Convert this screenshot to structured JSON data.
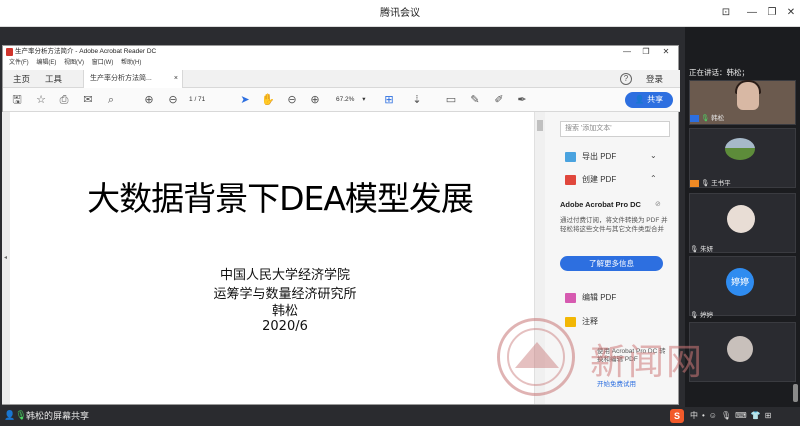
{
  "meeting": {
    "title": "腾讯会议",
    "speaking_label": "正在讲话：韩松；",
    "share_label": "韩松的屏幕共享"
  },
  "acrobat": {
    "window_title": "生产率分析方法简介 - Adobe Acrobat Reader DC",
    "menu": [
      "文件(F)",
      "编辑(E)",
      "视图(V)",
      "窗口(W)",
      "帮助(H)"
    ],
    "tabs": {
      "home": "主页",
      "tools": "工具",
      "document": "生产率分析方法简..."
    },
    "help": "?",
    "login": "登录",
    "page_current": "1",
    "page_total": "/ 71",
    "zoom": "67.2%",
    "share_button": "共享"
  },
  "slide": {
    "title": "大数据背景下DEA模型发展",
    "lines": [
      "中国人民大学经济学院",
      "运筹学与数量经济研究所",
      "韩松",
      "2020/6"
    ]
  },
  "right_panel": {
    "search_placeholder": "搜索 '添加文本'",
    "items": [
      "导出 PDF",
      "创建 PDF",
      "编辑 PDF",
      "注释"
    ],
    "promo_title": "Adobe Acrobat Pro DC",
    "promo_desc": "通过付费订阅，将文件转换为 PDF 并轻松将这些文件与其它文件类型合并",
    "promo_button": "了解更多信息",
    "footer_text": "使用 Acrobat Pro DC 转换和编辑 PDF",
    "footer_link": "开始免费试用"
  },
  "participants": [
    {
      "name": "韩松"
    },
    {
      "name": "王书平"
    },
    {
      "name": "朱妍"
    },
    {
      "name": "婷婷",
      "avatar_text": "婷婷"
    },
    {
      "name": ""
    }
  ],
  "watermark": {
    "text": "新闻网"
  },
  "colors": {
    "accent": "#2d6fe0",
    "pdf_red": "#d0342c",
    "watermark": "#cd7878"
  }
}
